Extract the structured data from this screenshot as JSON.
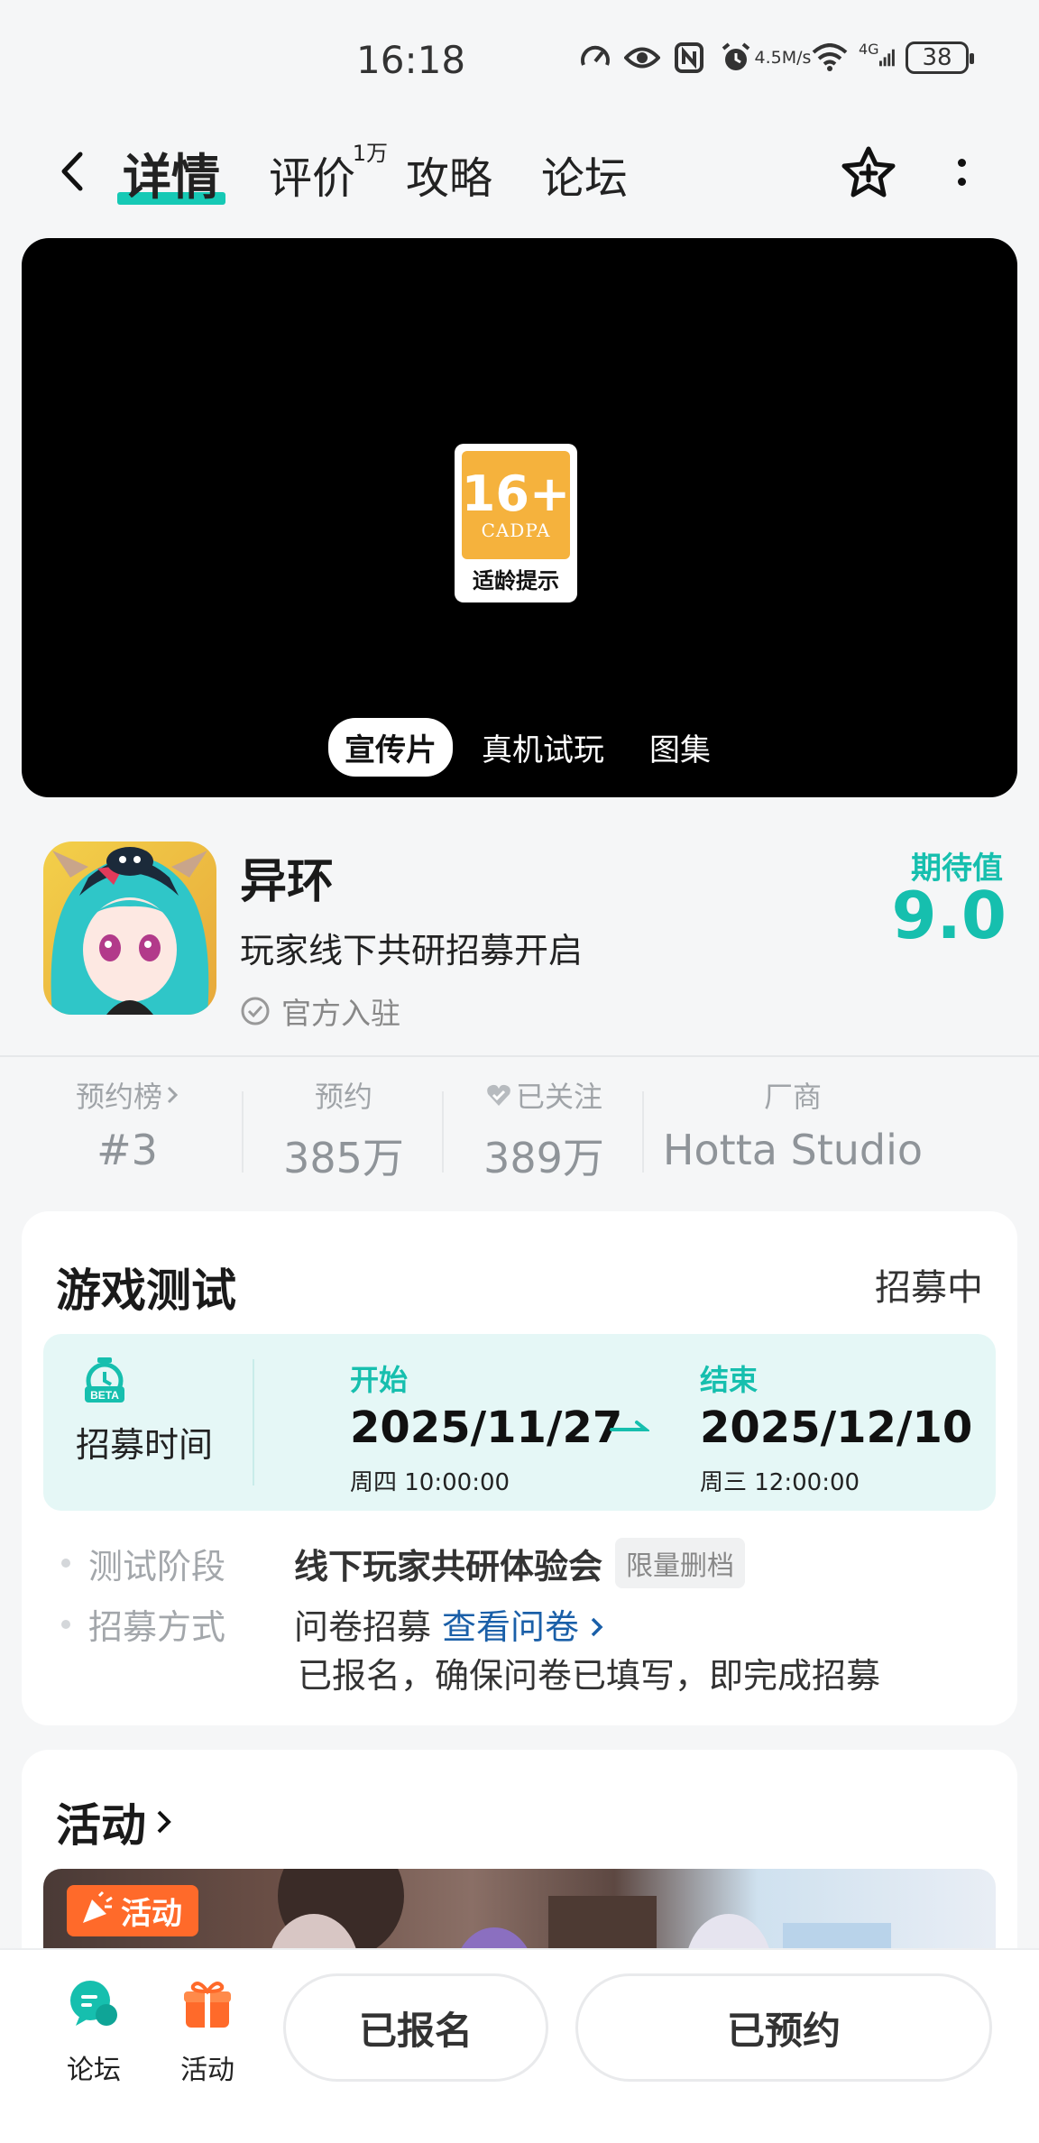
{
  "status_bar": {
    "time": "16:18",
    "net_speed_value": "4.5",
    "net_speed_unit": "M/s",
    "network": "4G",
    "battery": "38"
  },
  "nav": {
    "tabs": [
      {
        "label": "详情",
        "active": true
      },
      {
        "label": "评价",
        "badge": "1万"
      },
      {
        "label": "攻略"
      },
      {
        "label": "论坛"
      }
    ]
  },
  "media": {
    "rating": {
      "age": "16+",
      "org": "CADPA",
      "tip": "适龄提示"
    },
    "tabs": [
      "宣传片",
      "真机试玩",
      "图集"
    ]
  },
  "game": {
    "name": "异环",
    "slogan": "玩家线下共研招募开启",
    "official": "官方入驻",
    "expect_label": "期待值",
    "expect_value": "9.0"
  },
  "stats": [
    {
      "label": "预约榜",
      "value": "#3"
    },
    {
      "label": "预约",
      "value": "385万"
    },
    {
      "label": "已关注",
      "value": "389万"
    },
    {
      "label": "厂商",
      "value": "Hotta Studio"
    }
  ],
  "test": {
    "title": "游戏测试",
    "status": "招募中",
    "recruit_time_label": "招募时间",
    "beta_label": "BETA",
    "start": {
      "label": "开始",
      "date": "2025/11/27",
      "sub": "周四  10:00:00"
    },
    "end": {
      "label": "结束",
      "date": "2025/12/10",
      "sub": "周三  12:00:00"
    },
    "stage_key": "测试阶段",
    "stage_value": "线下玩家共研体验会",
    "stage_tag": "限量删档",
    "method_key": "招募方式",
    "method_value": "问卷招募",
    "method_link": "查看问卷",
    "note": "已报名，确保问卷已填写，即完成招募"
  },
  "activity": {
    "title": "活动",
    "tag": "活动"
  },
  "bottom_bar": {
    "forum_label": "论坛",
    "activity_label": "活动",
    "signed_up": "已报名",
    "reserved": "已预约"
  }
}
